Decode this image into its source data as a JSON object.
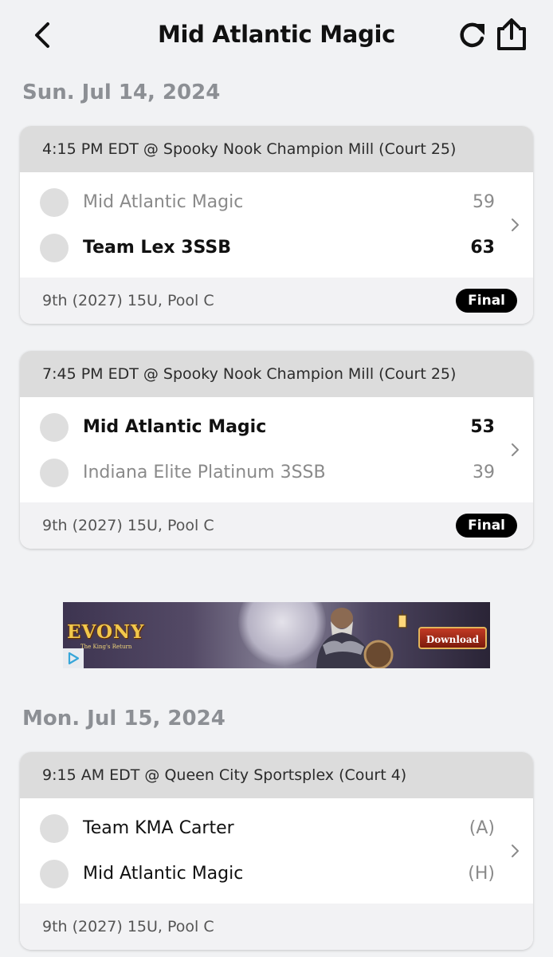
{
  "header": {
    "title": "Mid Atlantic Magic",
    "back_icon": "chevron-left-icon",
    "refresh_icon": "refresh-icon",
    "share_icon": "share-icon"
  },
  "days": [
    {
      "date": "Sun. Jul 14, 2024",
      "games": [
        {
          "time_location": "4:15 PM EDT @ Spooky Nook Champion Mill (Court 25)",
          "teams": [
            {
              "name": "Mid Atlantic Magic",
              "score": "59",
              "state": "lose"
            },
            {
              "name": "Team Lex 3SSB",
              "score": "63",
              "state": "win"
            }
          ],
          "division": "9th (2027) 15U, Pool C",
          "status": "Final"
        },
        {
          "time_location": "7:45 PM EDT @ Spooky Nook Champion Mill (Court 25)",
          "teams": [
            {
              "name": "Mid Atlantic Magic",
              "score": "53",
              "state": "win"
            },
            {
              "name": "Indiana Elite Platinum 3SSB",
              "score": "39",
              "state": "lose"
            }
          ],
          "division": "9th (2027) 15U, Pool C",
          "status": "Final"
        }
      ]
    },
    {
      "date": "Mon. Jul 15, 2024",
      "games": [
        {
          "time_location": "9:15 AM EDT @ Queen City Sportsplex (Court 4)",
          "teams": [
            {
              "name": "Team KMA Carter",
              "score": "(A)",
              "state": "neutral"
            },
            {
              "name": "Mid Atlantic Magic",
              "score": "(H)",
              "state": "neutral"
            }
          ],
          "division": "9th (2027) 15U, Pool C",
          "status": ""
        }
      ]
    }
  ],
  "ad": {
    "logo": "EVONY",
    "tagline": "The King's Return",
    "button": "Download"
  },
  "colors": {
    "background": "#f1f2f4",
    "card_header": "#dcdcdc",
    "card_footer": "#f2f2f4",
    "badge": "#000000",
    "muted_text": "#8a8a8a"
  }
}
